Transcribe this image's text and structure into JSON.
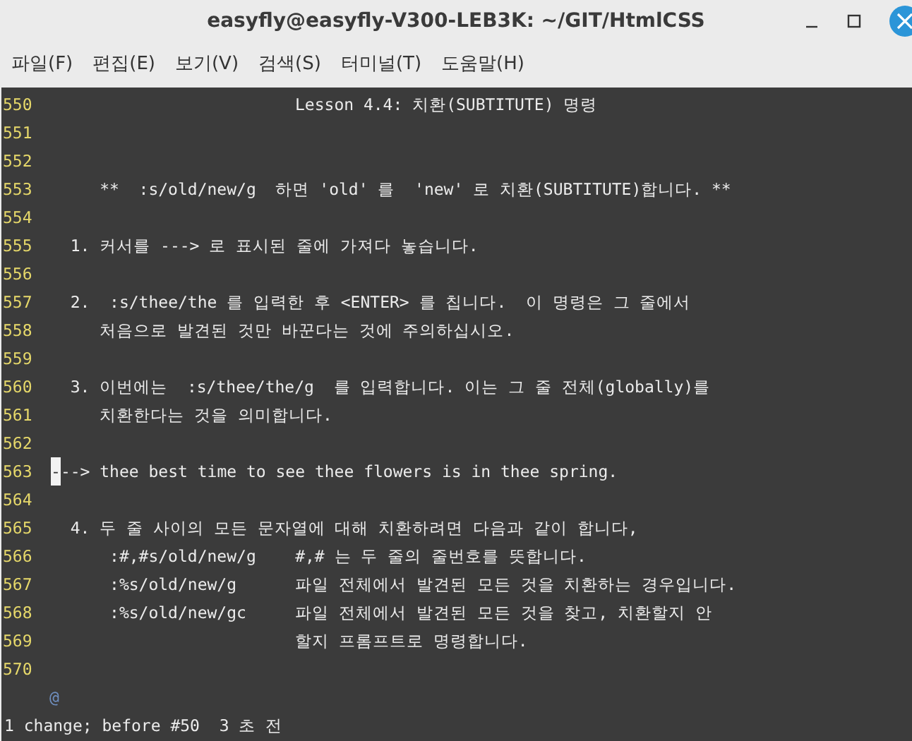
{
  "window": {
    "title": "easyfly@easyfly-V300-LEB3K: ~/GIT/HtmlCSS"
  },
  "menu": [
    "파일(F)",
    "편집(E)",
    "보기(V)",
    "검색(S)",
    "터미널(T)",
    "도움말(H)"
  ],
  "lines": [
    {
      "number": "550",
      "text": "                         Lesson 4.4: 치환(SUBTITUTE) 명령",
      "cursor": false
    },
    {
      "number": "551",
      "cursor": false
    },
    {
      "number": "552",
      "cursor": false
    },
    {
      "number": "553",
      "text": "     **  :s/old/new/g  하면 'old' 를  'new' 로 치환(SUBTITUTE)합니다. **",
      "cursor": false
    },
    {
      "number": "554",
      "cursor": false
    },
    {
      "number": "555",
      "text": "  1. 커서를 ---> 로 표시된 줄에 가져다 놓습니다.",
      "cursor": false
    },
    {
      "number": "556",
      "cursor": false
    },
    {
      "number": "557",
      "text": "  2.  :s/thee/the 를 입력한 후 <ENTER> 를 칩니다.  이 명령은 그 줄에서",
      "cursor": false
    },
    {
      "number": "558",
      "text": "     처음으로 발견된 것만 바꾼다는 것에 주의하십시오.",
      "cursor": false
    },
    {
      "number": "559",
      "cursor": false
    },
    {
      "number": "560",
      "text": "  3. 이번에는  :s/thee/the/g  를 입력합니다. 이는 그 줄 전체(globally)를",
      "cursor": false
    },
    {
      "number": "561",
      "text": "     치환한다는 것을 의미합니다.",
      "cursor": false
    },
    {
      "number": "562",
      "cursor": false
    },
    {
      "number": "563",
      "text": "---> thee best time to see thee flowers is in thee spring.",
      "cursor": true
    },
    {
      "number": "564",
      "cursor": false
    },
    {
      "number": "565",
      "text": "  4. 두 줄 사이의 모든 문자열에 대해 치환하려면 다음과 같이 합니다,",
      "cursor": false
    },
    {
      "number": "566",
      "text": "      :#,#s/old/new/g    #,# 는 두 줄의 줄번호를 뜻합니다.",
      "cursor": false
    },
    {
      "number": "567",
      "text": "      :%s/old/new/g      파일 전체에서 발견된 모든 것을 치환하는 경우입니다.",
      "cursor": false
    },
    {
      "number": "568",
      "text": "      :%s/old/new/gc     파일 전체에서 발견된 모든 것을 찾고, 치환할지 안",
      "cursor": false
    },
    {
      "number": "569",
      "text": "                         할지 프롬프트로 명령합니다.",
      "cursor": false
    },
    {
      "number": "570",
      "cursor": false
    }
  ],
  "overflow_marker": "@",
  "status_line": "1 change; before #50  3 초 전"
}
